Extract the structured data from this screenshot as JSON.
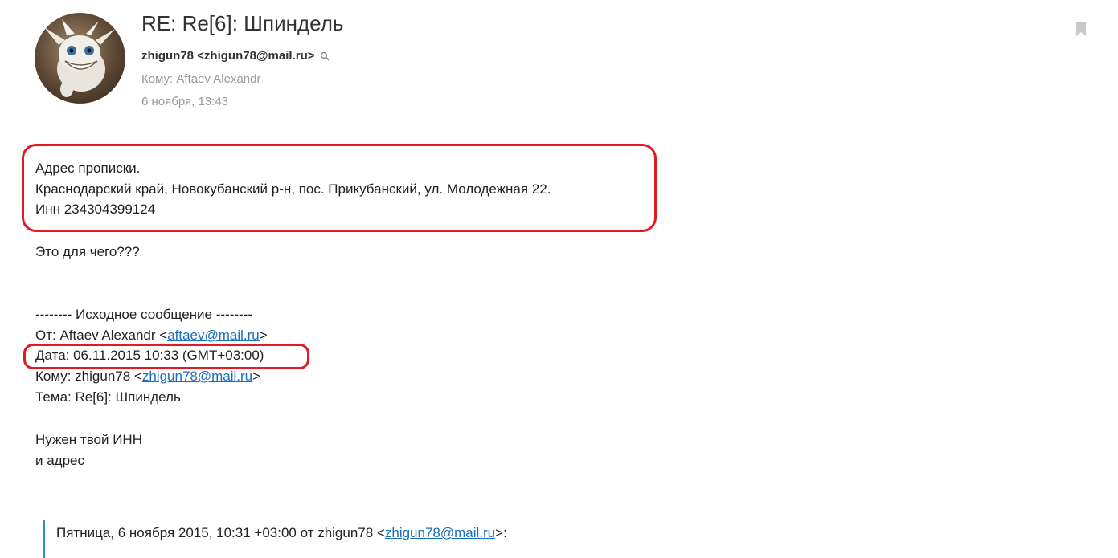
{
  "header": {
    "subject": "RE: Re[6]: Шпиндель",
    "sender": "zhigun78 <zhigun78@mail.ru>",
    "to": "Кому: Aftaev Alexandr",
    "date": "6 ноября, 13:43"
  },
  "body": {
    "address_title": "Адрес прописки.",
    "address_line": "Краснодарский край, Новокубанский р-н, пос. Прикубанский, ул. Молодежная 22.",
    "inn_line": "Инн 234304399124",
    "question": "Это для чего???",
    "original_separator": "-------- Исходное сообщение --------",
    "from_prefix": "От: Aftaev Alexandr <",
    "from_email": "aftaev@mail.ru",
    "from_suffix": ">",
    "date_line": "Дата: 06.11.2015 10:33 (GMT+03:00)",
    "to_prefix": "Кому: zhigun78 <",
    "to_email": "zhigun78@mail.ru",
    "to_suffix": ">",
    "subject_line": "Тема: Re[6]: Шпиндель",
    "request_line1": "Нужен твой ИНН",
    "request_line2": "и адрес",
    "quote_prefix": "Пятница, 6 ноября 2015, 10:31 +03:00 от zhigun78 <",
    "quote_email": "zhigun78@mail.ru",
    "quote_suffix": ">:"
  },
  "colors": {
    "highlight": "#e01b24",
    "link": "#1a6fbb",
    "quote_bar": "#2a8fd6"
  }
}
